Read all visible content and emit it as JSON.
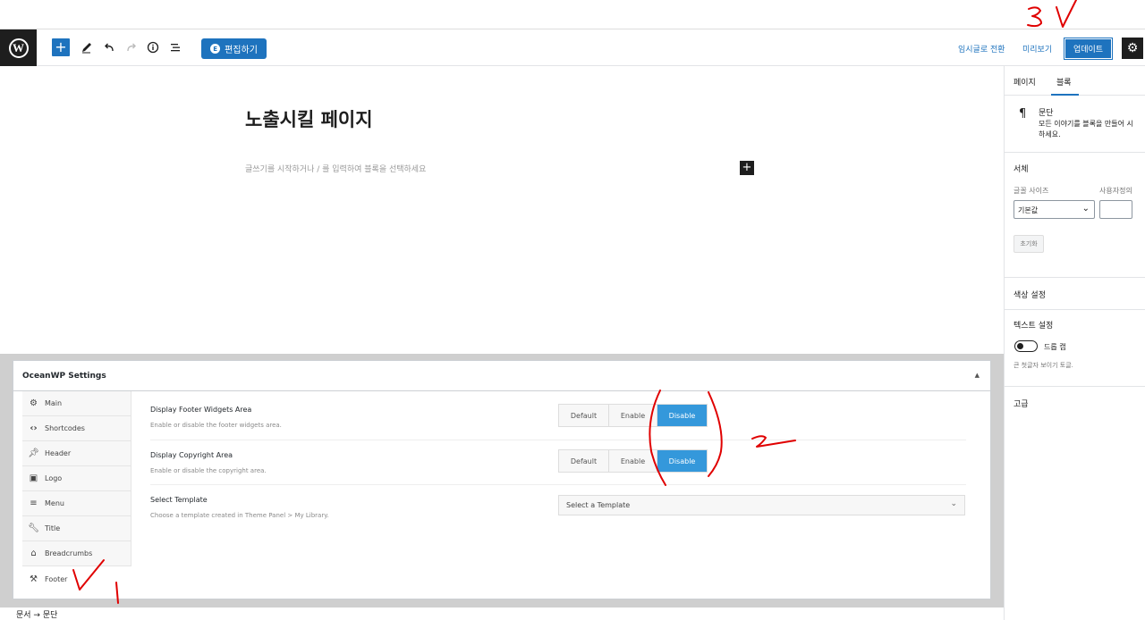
{
  "toolbar": {
    "logo_letter": "W",
    "add_label": "+",
    "elementor_label": "편집하기",
    "save_draft": "임시글로 전환",
    "preview": "미리보기",
    "update": "업데이트"
  },
  "editor": {
    "title": "노출시킬 페이지",
    "placeholder": "글쓰기를 시작하거나 / 를 입력하여 블록을 선택하세요",
    "inline_add": "+"
  },
  "sidebar": {
    "tabs": [
      "페이지",
      "블록"
    ],
    "active_tab": 1,
    "block_name": "문단",
    "block_desc_1": "모든 이야기를 블록을 만들어 시",
    "block_desc_2": "하세요.",
    "typography_title": "서체",
    "font_size_label": "글꼴 사이즈",
    "custom_label": "사용자정의",
    "font_size_value": "기본값",
    "reset_label": "초기화",
    "color_title": "색상 설정",
    "text_settings_title": "텍스트 설정",
    "drop_cap_label": "드롭 캡",
    "drop_cap_help": "큰 첫글자 보이기 토글.",
    "advanced_title": "고급"
  },
  "oceanwp": {
    "title": "OceanWP Settings",
    "nav": [
      {
        "label": "Main",
        "icon": "gear-icon"
      },
      {
        "label": "Shortcodes",
        "icon": "code-icon"
      },
      {
        "label": "Header",
        "icon": "pin-icon"
      },
      {
        "label": "Logo",
        "icon": "image-icon"
      },
      {
        "label": "Menu",
        "icon": "menu-icon"
      },
      {
        "label": "Title",
        "icon": "wrench-icon"
      },
      {
        "label": "Breadcrumbs",
        "icon": "home-icon"
      },
      {
        "label": "Footer",
        "icon": "hammer-icon"
      }
    ],
    "options": [
      {
        "label": "Display Footer Widgets Area",
        "desc": "Enable or disable the footer widgets area.",
        "buttons": [
          "Default",
          "Enable",
          "Disable"
        ],
        "selected": "Disable"
      },
      {
        "label": "Display Copyright Area",
        "desc": "Enable or disable the copyright area.",
        "buttons": [
          "Default",
          "Enable",
          "Disable"
        ],
        "selected": "Disable"
      },
      {
        "label": "Select Template",
        "desc": "Choose a template created in Theme Panel > My Library.",
        "select_value": "Select a Template"
      }
    ]
  },
  "statusbar": {
    "breadcrumb": "문서 → 문단"
  },
  "colors": {
    "accent": "#1e73be",
    "ocean_active": "#3498db",
    "annotation": "#e00000"
  }
}
